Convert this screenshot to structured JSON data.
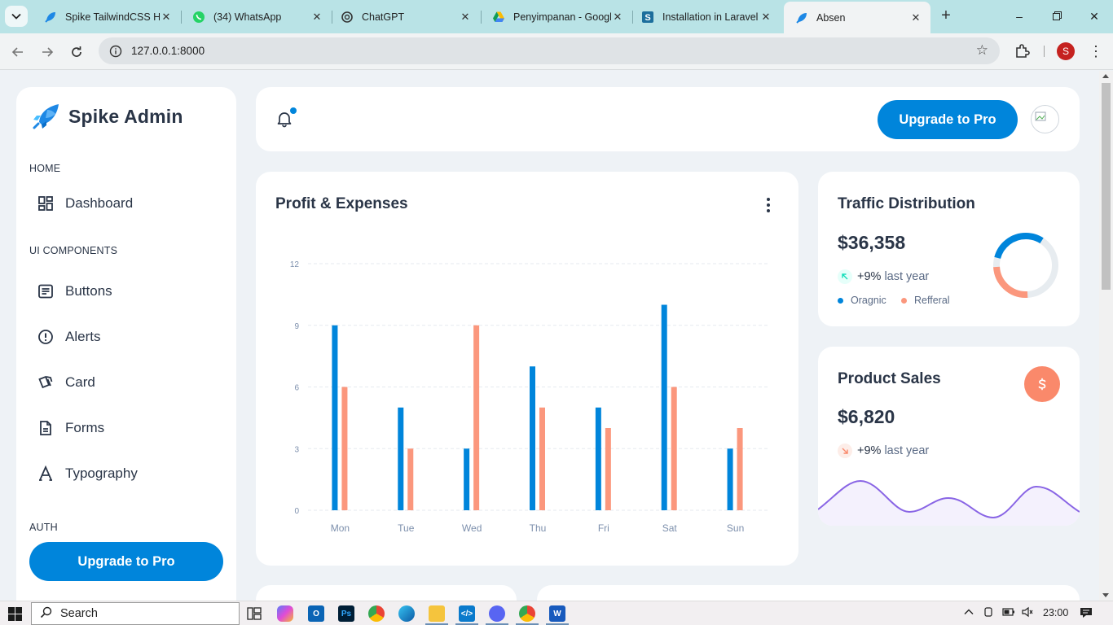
{
  "browser": {
    "tabs": [
      {
        "title": "Spike TailwindCSS HTML",
        "icon": "spike-icon"
      },
      {
        "title": "(34) WhatsApp",
        "icon": "whatsapp-icon"
      },
      {
        "title": "ChatGPT",
        "icon": "chatgpt-icon"
      },
      {
        "title": "Penyimpanan - Google Drive",
        "icon": "google-drive-icon"
      },
      {
        "title": "Installation in Laravel",
        "icon": "s-icon"
      },
      {
        "title": "Absen",
        "icon": "spike-icon"
      }
    ],
    "url": "127.0.0.1:8000",
    "profile_initial": "S"
  },
  "sidebar": {
    "brand": "Spike Admin",
    "sections": [
      {
        "label": "HOME"
      },
      {
        "label": "UI COMPONENTS"
      },
      {
        "label": "AUTH"
      }
    ],
    "items": [
      {
        "label": "Dashboard",
        "icon": "dashboard-icon"
      },
      {
        "label": "Buttons",
        "icon": "article-icon"
      },
      {
        "label": "Alerts",
        "icon": "alert-circle-icon"
      },
      {
        "label": "Card",
        "icon": "cards-icon"
      },
      {
        "label": "Forms",
        "icon": "file-description-icon"
      },
      {
        "label": "Typography",
        "icon": "typography-icon"
      }
    ],
    "upgrade_label": "Upgrade to Pro"
  },
  "header": {
    "upgrade_label": "Upgrade to Pro"
  },
  "profit": {
    "title": "Profit & Expenses"
  },
  "traffic": {
    "title": "Traffic Distribution",
    "value": "$36,358",
    "trend_pct": "+9%",
    "trend_period": "last year",
    "legend": [
      "Oragnic",
      "Refferal"
    ],
    "donut": {
      "organic": 0.62,
      "refferal": 0.38,
      "remaining": 0.0
    }
  },
  "sales": {
    "title": "Product Sales",
    "value": "$6,820",
    "trend_pct": "+9%",
    "trend_period": "last year"
  },
  "colors": {
    "primary": "#0085db",
    "secondary": "#fb977d",
    "text": "#2a3547",
    "purple": "#8965e5"
  },
  "taskbar": {
    "search_label": "Search",
    "time": "23:00"
  },
  "chart_data": {
    "type": "bar",
    "categories": [
      "Mon",
      "Tue",
      "Wed",
      "Thu",
      "Fri",
      "Sat",
      "Sun"
    ],
    "series": [
      {
        "values": [
          9,
          5,
          3,
          7,
          5,
          10,
          3
        ],
        "color": "#0085db"
      },
      {
        "values": [
          6,
          3,
          9,
          5,
          4,
          6,
          4
        ],
        "color": "#fb977d"
      }
    ],
    "yticks": [
      0,
      3,
      6,
      9,
      12
    ],
    "ylim": [
      0,
      12
    ],
    "grid": true
  }
}
